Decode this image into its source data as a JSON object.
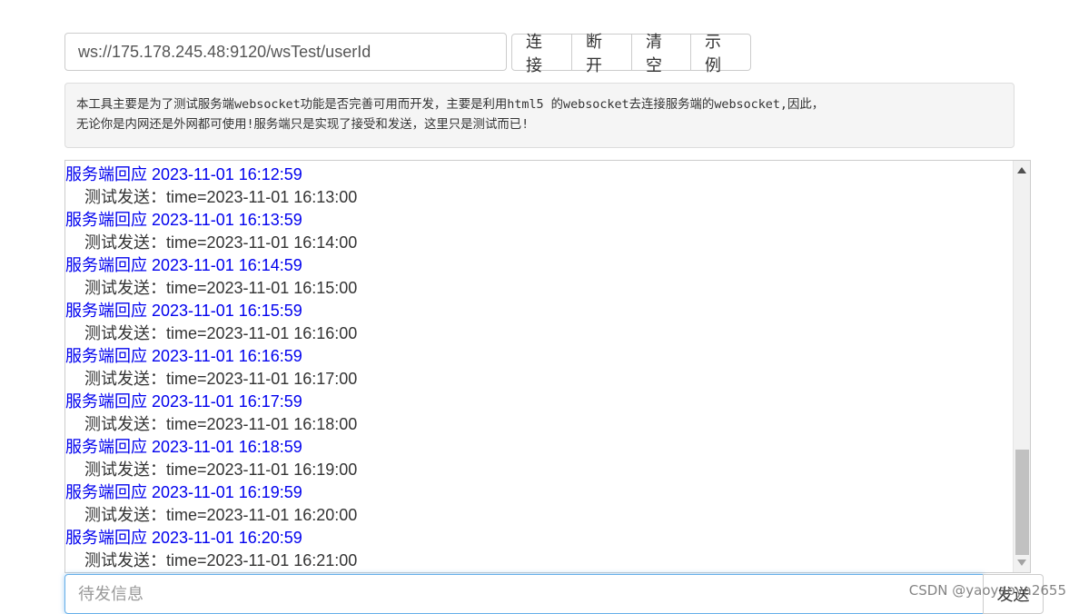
{
  "connection": {
    "url_value": "ws://175.178.245.48:9120/wsTest/userId",
    "buttons": {
      "connect": "连接",
      "disconnect": "断开",
      "clear": "清空",
      "example": "示例"
    }
  },
  "notice": {
    "line1": "本工具主要是为了测试服务端websocket功能是否完善可用而开发，主要是利用html5 的websocket去连接服务端的websocket,因此，",
    "line2": "无论你是内网还是外网都可使用!服务端只是实现了接受和发送，这里只是测试而已!"
  },
  "log": {
    "entries": [
      {
        "server": "服务端回应 2023-11-01 16:12:59",
        "message": "测试发送：time=2023-11-01 16:13:00"
      },
      {
        "server": "服务端回应 2023-11-01 16:13:59",
        "message": "测试发送：time=2023-11-01 16:14:00"
      },
      {
        "server": "服务端回应 2023-11-01 16:14:59",
        "message": "测试发送：time=2023-11-01 16:15:00"
      },
      {
        "server": "服务端回应 2023-11-01 16:15:59",
        "message": "测试发送：time=2023-11-01 16:16:00"
      },
      {
        "server": "服务端回应 2023-11-01 16:16:59",
        "message": "测试发送：time=2023-11-01 16:17:00"
      },
      {
        "server": "服务端回应 2023-11-01 16:17:59",
        "message": "测试发送：time=2023-11-01 16:18:00"
      },
      {
        "server": "服务端回应 2023-11-01 16:18:59",
        "message": "测试发送：time=2023-11-01 16:19:00"
      },
      {
        "server": "服务端回应 2023-11-01 16:19:59",
        "message": "测试发送：time=2023-11-01 16:20:00"
      },
      {
        "server": "服务端回应 2023-11-01 16:20:59",
        "message": "测试发送：time=2023-11-01 16:21:00"
      }
    ]
  },
  "send": {
    "placeholder": "待发信息",
    "button": "发送"
  },
  "watermark": "CSDN @yaoyaoya2655",
  "colors": {
    "server_text": "#0000ee",
    "focus_border": "#66afe9"
  }
}
